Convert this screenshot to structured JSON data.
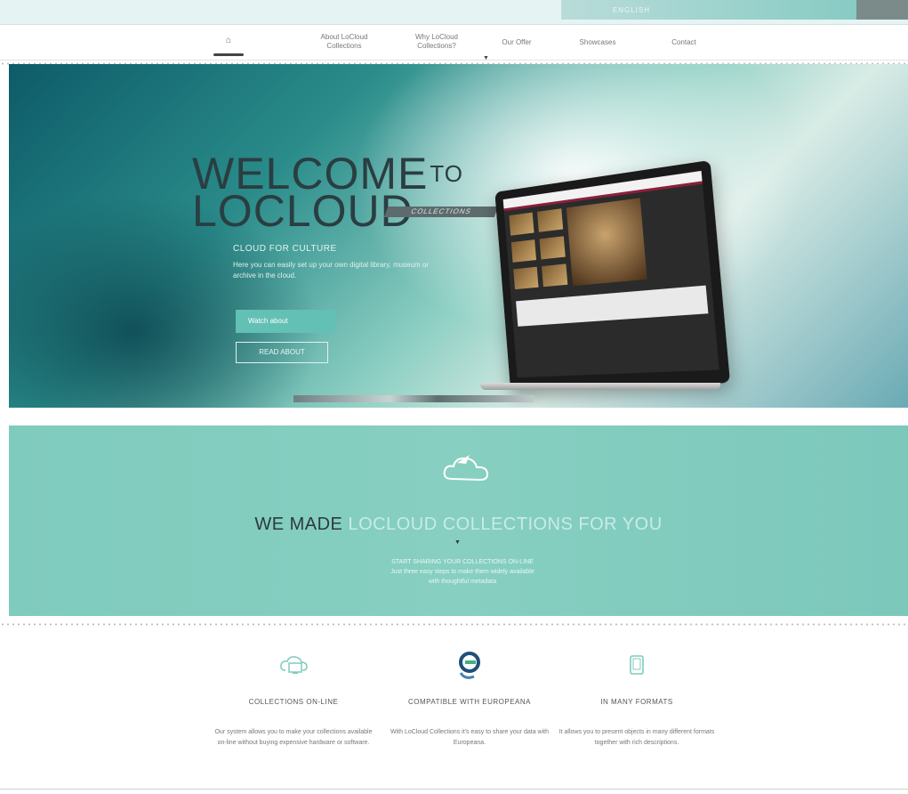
{
  "topbar": {
    "language": "ENGLISH",
    "links": [
      "",
      ""
    ]
  },
  "nav": {
    "items": [
      {
        "label": "About LoCloud Collections"
      },
      {
        "label": "Why LoCloud Collections?"
      },
      {
        "label": "Our Offer"
      },
      {
        "label": "Showcases"
      },
      {
        "label": "Contact"
      }
    ]
  },
  "hero": {
    "title_line1": "WELCOME",
    "title_to": "TO",
    "title_line2": "LOCLOUD",
    "collections_tag": "COLLECTIONS",
    "tagline": "CLOUD FOR CULTURE",
    "description": "Here you can easily set up your own digital library, museum or archive in the cloud.",
    "watch_button": "Watch about",
    "read_button": "READ ABOUT"
  },
  "band": {
    "headline_plain": "WE MADE ",
    "headline_accent": "LOCLOUD COLLECTIONS FOR YOU",
    "sub_line1": "START SHARING YOUR COLLECTIONS ON-LINE",
    "sub_line2": "Just three easy steps to make them widely available",
    "sub_line3": "with thoughtful metadata"
  },
  "features": [
    {
      "title": "COLLECTIONS ON-LINE",
      "description": "Our system allows you to make your collections available on-line without buying expensive hardware or software.",
      "icon": "cloud-monitor-icon"
    },
    {
      "title": "COMPATIBLE WITH EUROPEANA",
      "description": "With LoCloud Collections it's easy to share your data with Europeana.",
      "icon": "europeana-icon"
    },
    {
      "title": "IN MANY FORMATS",
      "description": "It allows you to present objects in many different formats together with rich descriptions.",
      "icon": "tablet-icon"
    }
  ],
  "colors": {
    "accent": "#7fcbbd",
    "dark_text": "#2d3a3b",
    "laptop_accent": "#8b1f3b"
  }
}
